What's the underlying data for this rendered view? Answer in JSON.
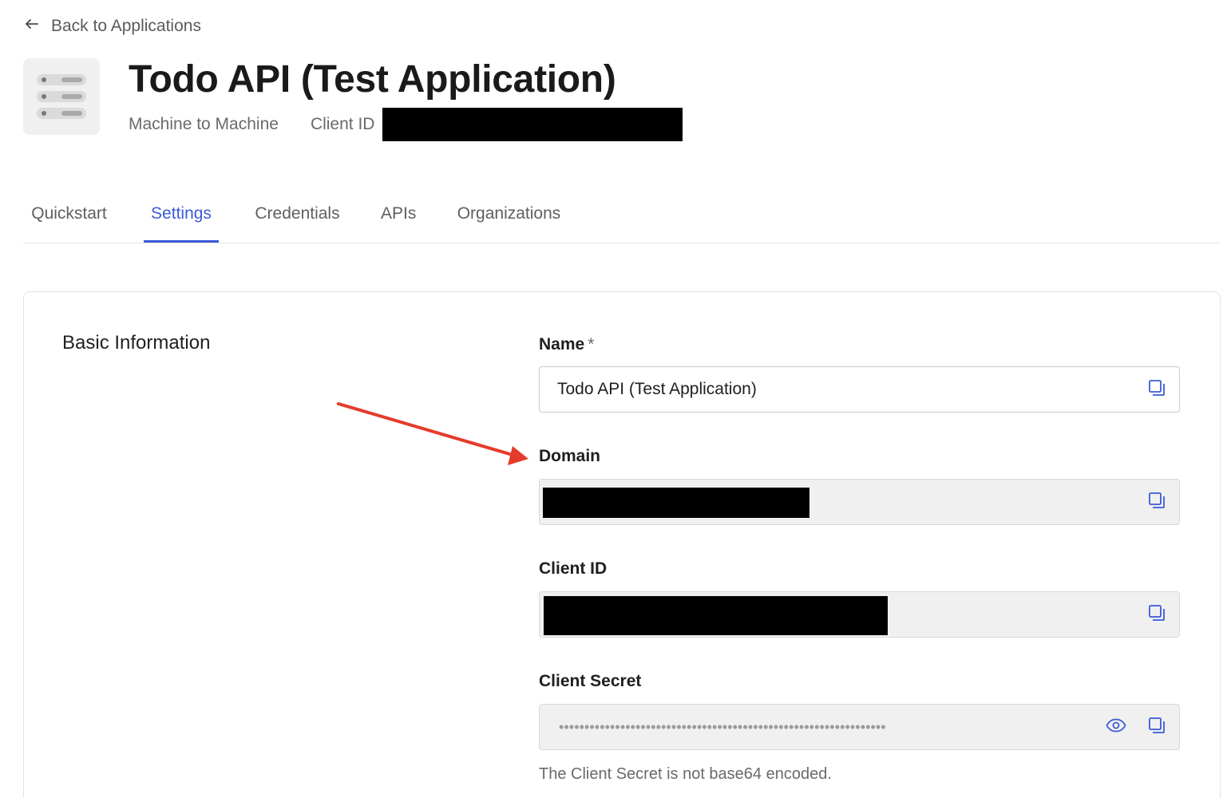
{
  "back_link": {
    "label": "Back to Applications",
    "icon": "arrow-left-icon"
  },
  "header": {
    "title": "Todo API (Test Application)",
    "app_type": "Machine to Machine",
    "client_id_label": "Client ID",
    "client_id_value": "[redacted]",
    "app_icon": "server-stack-icon"
  },
  "tabs": [
    {
      "label": "Quickstart",
      "active": false
    },
    {
      "label": "Settings",
      "active": true
    },
    {
      "label": "Credentials",
      "active": false
    },
    {
      "label": "APIs",
      "active": false
    },
    {
      "label": "Organizations",
      "active": false
    }
  ],
  "basic_info": {
    "section_title": "Basic Information",
    "name": {
      "label": "Name",
      "required_mark": "*",
      "value": "Todo API (Test Application)"
    },
    "domain": {
      "label": "Domain",
      "value": "[redacted]"
    },
    "client_id": {
      "label": "Client ID",
      "value": "[redacted]"
    },
    "client_secret": {
      "label": "Client Secret",
      "masked_value": "••••••••••••••••••••••••••••••••••••••••••••••••••••••••••••••••",
      "help_text": "The Client Secret is not base64 encoded."
    }
  },
  "colors": {
    "accent": "#3d5ad8",
    "annotation_arrow": "#e53b2c",
    "redaction": "#000000"
  }
}
